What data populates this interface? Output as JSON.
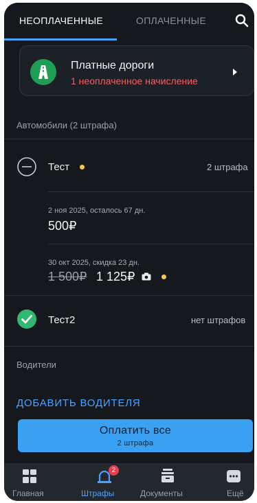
{
  "tabs": {
    "unpaid": "НЕОПЛАЧЕННЫЕ",
    "paid": "ОПЛАЧЕННЫЕ"
  },
  "icons": {
    "search": "search-icon",
    "toll": "road-icon",
    "arrow": "chevron-right-icon",
    "camera": "camera-icon"
  },
  "toll": {
    "title": "Платные дороги",
    "subtitle": "1 неоплаченное начисление"
  },
  "cars_section": "Автомобили (2 штрафа)",
  "cars": [
    {
      "name": "Тест",
      "count": "2 штрафа",
      "fines": [
        {
          "date": "2 ноя 2025, осталось 67 дн.",
          "amount": "500₽"
        },
        {
          "date": "30 окт 2025, скидка 23 дн.",
          "old_amount": "1 500₽",
          "amount": "1 125₽"
        }
      ]
    },
    {
      "name": "Тест2",
      "count": "нет штрафов"
    }
  ],
  "drivers_section": "Водители",
  "add_driver": "ДОБАВИТЬ ВОДИТЕЛЯ",
  "pay": {
    "label": "Оплатить все",
    "sub": "2 штрафа"
  },
  "nav": [
    {
      "label": "Главная"
    },
    {
      "label": "Штрафы",
      "badge": "2"
    },
    {
      "label": "Документы"
    },
    {
      "label": "Ещё"
    }
  ],
  "colors": {
    "background": "#15191e",
    "accent": "#4aa3ff",
    "alert": "#ff5a5f",
    "success": "#2eb872",
    "dot": "#f2c94c"
  }
}
